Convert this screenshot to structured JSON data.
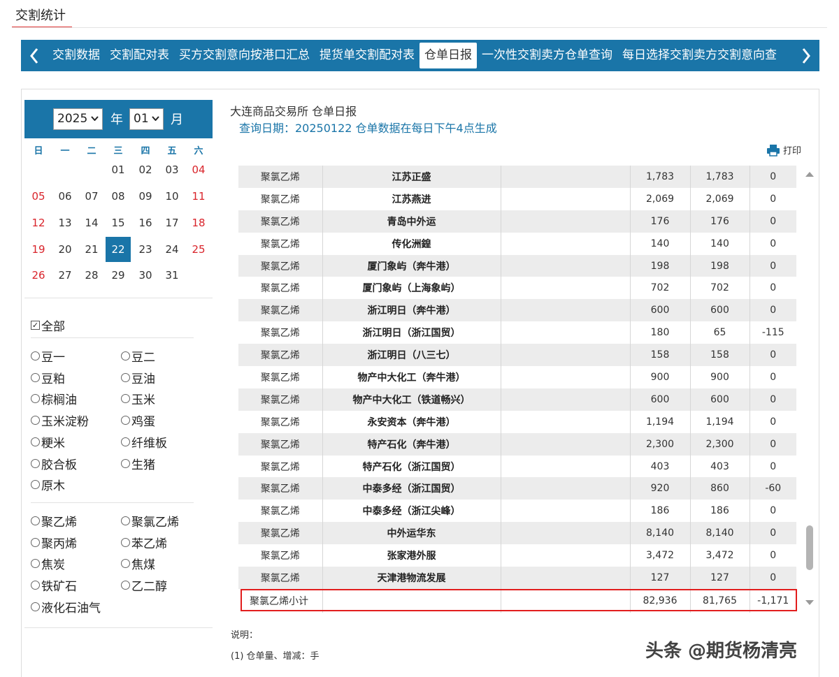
{
  "page": {
    "title": "交割统计"
  },
  "tabs": {
    "items": [
      "交割数据",
      "交割配对表",
      "买方交割意向按港口汇总",
      "提货单交割配对表",
      "仓单日报",
      "一次性交割卖方仓单查询",
      "每日选择交割卖方交割意向查"
    ],
    "active_index": 4
  },
  "calendar": {
    "year": "2025",
    "year_label": "年",
    "month": "01",
    "month_label": "月",
    "weekdays": [
      "日",
      "一",
      "二",
      "三",
      "四",
      "五",
      "六"
    ],
    "days": [
      "01",
      "02",
      "03",
      "04",
      "05",
      "06",
      "07",
      "08",
      "09",
      "10",
      "11",
      "12",
      "13",
      "14",
      "15",
      "16",
      "17",
      "18",
      "19",
      "20",
      "21",
      "22",
      "23",
      "24",
      "25",
      "26",
      "27",
      "28",
      "29",
      "30",
      "31"
    ],
    "selected_day": "22"
  },
  "filters": {
    "all_label": "全部",
    "all_checked": true,
    "group1": [
      "豆一",
      "豆二",
      "豆粕",
      "豆油",
      "棕榈油",
      "玉米",
      "玉米淀粉",
      "鸡蛋",
      "粳米",
      "纤维板",
      "胶合板",
      "生猪",
      "原木"
    ],
    "group2": [
      "聚乙烯",
      "聚氯乙烯",
      "聚丙烯",
      "苯乙烯",
      "焦炭",
      "焦煤",
      "铁矿石",
      "乙二醇",
      "液化石油气"
    ]
  },
  "report": {
    "exchange_title": "大连商品交易所 仓单日报",
    "query_date_text": "查询日期：20250122 仓单数据在每日下午4点生成",
    "print_label": "打印"
  },
  "table": {
    "rows": [
      {
        "variety": "聚氯乙烯",
        "warehouse": "江苏正盛",
        "prev": "1,783",
        "today": "1,783",
        "change": "0"
      },
      {
        "variety": "聚氯乙烯",
        "warehouse": "江苏燕进",
        "prev": "2,069",
        "today": "2,069",
        "change": "0"
      },
      {
        "variety": "聚氯乙烯",
        "warehouse": "青岛中外运",
        "prev": "176",
        "today": "176",
        "change": "0"
      },
      {
        "variety": "聚氯乙烯",
        "warehouse": "传化洲鍠",
        "prev": "140",
        "today": "140",
        "change": "0"
      },
      {
        "variety": "聚氯乙烯",
        "warehouse": "厦门象屿（奔牛港）",
        "prev": "198",
        "today": "198",
        "change": "0"
      },
      {
        "variety": "聚氯乙烯",
        "warehouse": "厦门象屿（上海象屿）",
        "prev": "702",
        "today": "702",
        "change": "0"
      },
      {
        "variety": "聚氯乙烯",
        "warehouse": "浙江明日（奔牛港）",
        "prev": "600",
        "today": "600",
        "change": "0"
      },
      {
        "variety": "聚氯乙烯",
        "warehouse": "浙江明日（浙江国贸）",
        "prev": "180",
        "today": "65",
        "change": "-115"
      },
      {
        "variety": "聚氯乙烯",
        "warehouse": "浙江明日（八三七）",
        "prev": "158",
        "today": "158",
        "change": "0"
      },
      {
        "variety": "聚氯乙烯",
        "warehouse": "物产中大化工（奔牛港）",
        "prev": "900",
        "today": "900",
        "change": "0"
      },
      {
        "variety": "聚氯乙烯",
        "warehouse": "物产中大化工（铁道畅兴）",
        "prev": "600",
        "today": "600",
        "change": "0"
      },
      {
        "variety": "聚氯乙烯",
        "warehouse": "永安资本（奔牛港）",
        "prev": "1,194",
        "today": "1,194",
        "change": "0"
      },
      {
        "variety": "聚氯乙烯",
        "warehouse": "特产石化（奔牛港）",
        "prev": "2,300",
        "today": "2,300",
        "change": "0"
      },
      {
        "variety": "聚氯乙烯",
        "warehouse": "特产石化（浙江国贸）",
        "prev": "403",
        "today": "403",
        "change": "0"
      },
      {
        "variety": "聚氯乙烯",
        "warehouse": "中泰多经（浙江国贸）",
        "prev": "920",
        "today": "860",
        "change": "-60"
      },
      {
        "variety": "聚氯乙烯",
        "warehouse": "中泰多经（浙江尖峰）",
        "prev": "186",
        "today": "186",
        "change": "0"
      },
      {
        "variety": "聚氯乙烯",
        "warehouse": "中外运华东",
        "prev": "8,140",
        "today": "8,140",
        "change": "0"
      },
      {
        "variety": "聚氯乙烯",
        "warehouse": "张家港外服",
        "prev": "3,472",
        "today": "3,472",
        "change": "0"
      },
      {
        "variety": "聚氯乙烯",
        "warehouse": "天津港物流发展",
        "prev": "127",
        "today": "127",
        "change": "0"
      }
    ],
    "subtotal": {
      "label": "聚氯乙烯小计",
      "prev": "82,936",
      "today": "81,765",
      "change": "-1,171"
    }
  },
  "notes": {
    "title": "说明：",
    "line1": "(1) 仓单量、增减：手"
  },
  "watermark": "头条 @期货杨清亮"
}
